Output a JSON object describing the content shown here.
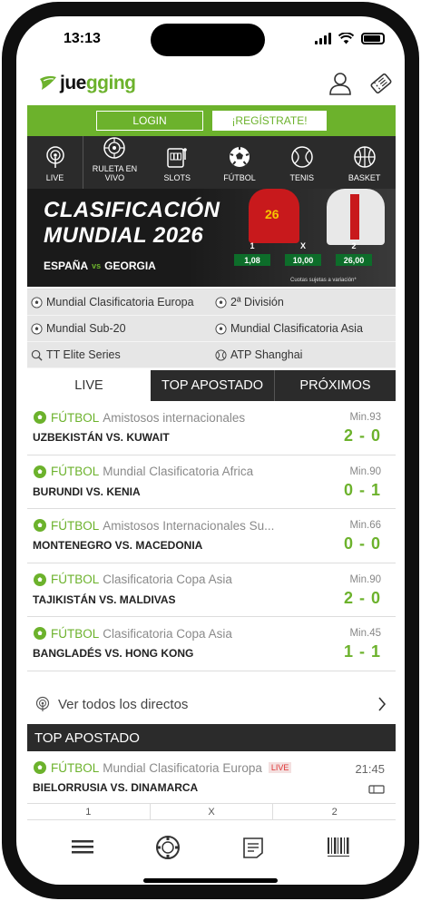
{
  "status": {
    "time": "13:13"
  },
  "header": {
    "logo_text_dark": "jue",
    "logo_text_green": "gging",
    "logo_text_dark2": ""
  },
  "auth": {
    "login": "LOGIN",
    "register": "¡REGÍSTRATE!"
  },
  "sports_nav": [
    {
      "label": "LIVE",
      "icon": "live-icon"
    },
    {
      "label": "RULETA EN VIVO",
      "icon": "roulette-icon"
    },
    {
      "label": "SLOTS",
      "icon": "slots-icon"
    },
    {
      "label": "FÚTBOL",
      "icon": "football-icon"
    },
    {
      "label": "TENIS",
      "icon": "tennis-icon"
    },
    {
      "label": "BASKET",
      "icon": "basket-icon"
    }
  ],
  "banner": {
    "title_line1": "CLASIFICACIÓN",
    "title_line2": "MUNDIAL 2026",
    "team1": "ESPAÑA",
    "vs": "vs",
    "team2": "GEORGIA",
    "player_number": "26",
    "odds": [
      {
        "label": "1",
        "value": "1,08"
      },
      {
        "label": "X",
        "value": "10,00"
      },
      {
        "label": "2",
        "value": "26,00"
      }
    ],
    "note": "Cuotas sujetas a variación*"
  },
  "competitions": [
    {
      "label": "Mundial Clasificatoria Europa",
      "icon": "football-icon"
    },
    {
      "label": "2ª División",
      "icon": "football-icon"
    },
    {
      "label": "Mundial Sub-20",
      "icon": "football-icon"
    },
    {
      "label": "Mundial Clasificatoria Asia",
      "icon": "football-icon"
    },
    {
      "label": "TT Elite Series",
      "icon": "table-tennis-icon"
    },
    {
      "label": "ATP Shanghai",
      "icon": "tennis-icon"
    }
  ],
  "tabs": {
    "live": "LIVE",
    "top": "TOP APOSTADO",
    "next": "PRÓXIMOS"
  },
  "matches": [
    {
      "sport": "FÚTBOL",
      "competition": "Amistosos internacionales",
      "teams": "UZBEKISTÁN VS. KUWAIT",
      "minute": "Min.93",
      "score": "2 - 0"
    },
    {
      "sport": "FÚTBOL",
      "competition": "Mundial Clasificatoria Africa",
      "teams": "BURUNDI VS. KENIA",
      "minute": "Min.90",
      "score": "0 - 1"
    },
    {
      "sport": "FÚTBOL",
      "competition": "Amistosos Internacionales Su...",
      "teams": "MONTENEGRO VS. MACEDONIA",
      "minute": "Min.66",
      "score": "0 - 0"
    },
    {
      "sport": "FÚTBOL",
      "competition": "Clasificatoria Copa Asia",
      "teams": "TAJIKISTÁN VS. MALDIVAS",
      "minute": "Min.90",
      "score": "2 - 0"
    },
    {
      "sport": "FÚTBOL",
      "competition": "Clasificatoria Copa Asia",
      "teams": "BANGLADÉS VS. HONG KONG",
      "minute": "Min.45",
      "score": "1 - 1"
    }
  ],
  "see_all": "Ver todos los directos",
  "top_section": {
    "title": "TOP APOSTADO",
    "match": {
      "sport": "FÚTBOL",
      "competition": "Mundial Clasificatoria Europa",
      "badge": "LIVE",
      "teams": "BIELORRUSIA VS. DINAMARCA",
      "time": "21:45"
    },
    "odds_labels": [
      "1",
      "X",
      "2"
    ]
  },
  "bottom_nav": [
    {
      "icon": "menu-icon"
    },
    {
      "icon": "casino-chip-icon"
    },
    {
      "icon": "betslip-icon"
    },
    {
      "icon": "barcode-icon"
    }
  ],
  "colors": {
    "brand_green": "#6cb22c",
    "dark": "#2b2b2b",
    "odds_green": "#0d6d2a"
  }
}
